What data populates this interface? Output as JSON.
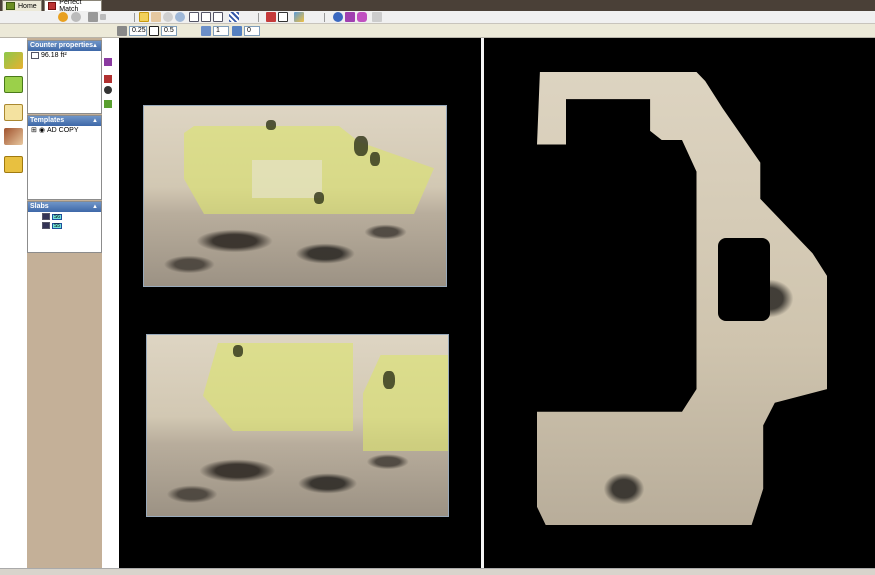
{
  "tabs": [
    {
      "label": "Home"
    },
    {
      "label": "Perfect Match"
    }
  ],
  "toolbar2": {
    "value_a": "0.25",
    "value_b": "0.5",
    "value_c": "1",
    "value_d": "0"
  },
  "panel": {
    "counter_properties": {
      "title": "Counter properties",
      "area": "96.18 ft²"
    },
    "templates": {
      "title": "Templates",
      "item": "AD COPY"
    },
    "slabs": {
      "title": "Slabs",
      "items": [
        "S6",
        "S5"
      ]
    }
  },
  "colors": {
    "accent_header": "#3e68a8",
    "canvas_bg": "#000000",
    "overlay": "#dce46e"
  },
  "icons": {
    "home_tab": "home-icon",
    "perfect_match_tab": "slab-match-icon"
  }
}
